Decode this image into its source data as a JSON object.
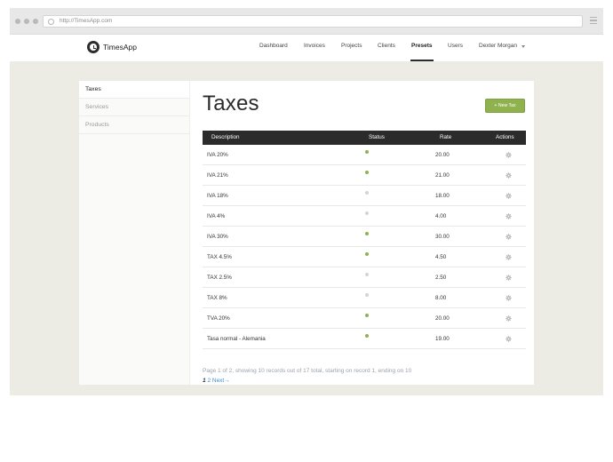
{
  "browser": {
    "url": "http://TimesApp.com"
  },
  "brand": {
    "name": "TimesApp"
  },
  "nav": {
    "items": [
      {
        "label": "Dashboard",
        "active": false
      },
      {
        "label": "Invoices",
        "active": false
      },
      {
        "label": "Projects",
        "active": false
      },
      {
        "label": "Clients",
        "active": false
      },
      {
        "label": "Presets",
        "active": true
      },
      {
        "label": "Users",
        "active": false
      }
    ],
    "user": "Dexter Morgan"
  },
  "sidebar": {
    "items": [
      {
        "label": "Taxes",
        "active": true
      },
      {
        "label": "Services",
        "active": false
      },
      {
        "label": "Products",
        "active": false
      }
    ]
  },
  "page": {
    "title": "Taxes",
    "new_button": "+ New Tax"
  },
  "table": {
    "headers": {
      "description": "Description",
      "status": "Status",
      "rate": "Rate",
      "actions": "Actions"
    },
    "rows": [
      {
        "description": "IVA 20%",
        "active": true,
        "rate": "20.00"
      },
      {
        "description": "IVA 21%",
        "active": true,
        "rate": "21.00"
      },
      {
        "description": "IVA 18%",
        "active": false,
        "rate": "18.00"
      },
      {
        "description": "IVA 4%",
        "active": false,
        "rate": "4.00"
      },
      {
        "description": "IVA 30%",
        "active": true,
        "rate": "30.00"
      },
      {
        "description": "TAX 4.5%",
        "active": true,
        "rate": "4.50"
      },
      {
        "description": "TAX 2.5%",
        "active": false,
        "rate": "2.50"
      },
      {
        "description": "TAX 8%",
        "active": false,
        "rate": "8.00"
      },
      {
        "description": "TVA 20%",
        "active": true,
        "rate": "20.00"
      },
      {
        "description": "Tasa normal - Alemania",
        "active": true,
        "rate": "19.00"
      }
    ]
  },
  "pagination": {
    "info": "Page 1 of 2, showing 10 records out of 17 total, starting on record 1, ending on 10",
    "current": "1",
    "page2": "2",
    "next": "Next→"
  },
  "colors": {
    "status_active": "#8fb24f",
    "status_inactive": "#d4d4d4",
    "accent": "#8fb24f",
    "table_header": "#2b2b2b",
    "link": "#3b8fd0"
  },
  "icons": {
    "logo": "clock-logo-icon",
    "action": "gear-icon",
    "browser_menu": "hamburger-icon"
  }
}
